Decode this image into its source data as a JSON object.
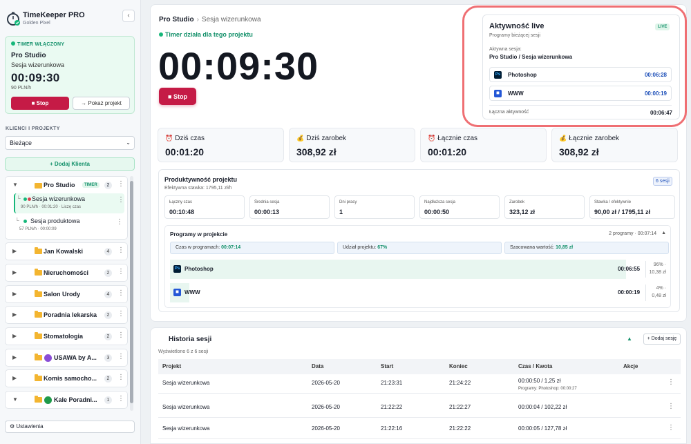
{
  "app": {
    "name": "TimeKeeper PRO",
    "subtitle": "Golden Pixel",
    "collapse_icon": "chevron-left-icon"
  },
  "sidebar": {
    "timer_card": {
      "label": "TIMER WŁĄCZONY",
      "project": "Pro Studio",
      "session": "Sesja wizerunkowa",
      "time": "00:09:30",
      "rate": "90 PLN/h",
      "stop_label": "■ Stop",
      "show_label": "→ Pokaż projekt"
    },
    "section_label": "KLIENCI I PROJEKTY",
    "filter_value": "Bieżące",
    "add_client_label": "+ Dodaj Klienta",
    "open_client": {
      "name": "Pro Studio",
      "tag": "TIMER",
      "count": "2",
      "sessions": [
        {
          "name": "Sesja wizerunkowa",
          "meta": "90 PLN/h · 00:01:20 · Liczę czas"
        },
        {
          "name": "Sesja produktowa",
          "meta": "57 PLN/h · 00:00:09"
        }
      ]
    },
    "clients": [
      {
        "name": "Jan Kowalski",
        "count": "4",
        "expanded": false
      },
      {
        "name": "Nieruchomości",
        "count": "2",
        "expanded": false
      },
      {
        "name": "Salon Urody",
        "count": "4",
        "expanded": false
      },
      {
        "name": "Poradnia lekarska",
        "count": "2",
        "expanded": false
      },
      {
        "name": "Stomatologia",
        "count": "2",
        "expanded": false
      },
      {
        "name": "USAWA by A...",
        "count": "3",
        "expanded": false,
        "icon_color": "#8a4dd6"
      },
      {
        "name": "Komis samocho...",
        "count": "2",
        "expanded": false
      },
      {
        "name": "Kale Poradni...",
        "count": "1",
        "expanded": true,
        "icon_color": "#1f9a4a"
      }
    ],
    "settings_label": "⚙ Ustawienia"
  },
  "main": {
    "breadcrumb": {
      "project": "Pro Studio",
      "separator": "›",
      "session": "Sesja wizerunkowa"
    },
    "status": "Timer działa dla tego projektu",
    "time": "00:09:30",
    "stop_label": "■ Stop",
    "live": {
      "title": "Aktywność live",
      "subtitle": "Programy bieżącej sesji",
      "badge": "LIVE",
      "active_label": "Aktywna sesja:",
      "active_value": "Pro Studio / Sesja wizerunkowa",
      "programs": [
        {
          "icon": "Ps",
          "name": "Photoshop",
          "time": "00:06:28"
        },
        {
          "icon": "◼",
          "name": "WWW",
          "time": "00:00:19"
        }
      ],
      "total_label": "Łączna aktywność",
      "total_value": "00:06:47"
    },
    "stats": [
      {
        "icon": "⏰",
        "label": "Dziś czas",
        "value": "00:01:20"
      },
      {
        "icon": "💰",
        "label": "Dziś zarobek",
        "value": "308,92 zł"
      },
      {
        "icon": "⏰",
        "label": "Łącznie czas",
        "value": "00:01:20"
      },
      {
        "icon": "💰",
        "label": "Łącznie zarobek",
        "value": "308,92 zł"
      }
    ],
    "productivity": {
      "title": "Produktywność projektu",
      "subtitle": "Efektywna stawka: 1795,11 zł/h",
      "badge": "6 sesji",
      "metrics": [
        {
          "label": "Łączny czas",
          "value": "00:10:48"
        },
        {
          "label": "Średnia sesja",
          "value": "00:00:13"
        },
        {
          "label": "Dni pracy",
          "value": "1"
        },
        {
          "label": "Najdłuższa sesja",
          "value": "00:00:50"
        },
        {
          "label": "Zarobek",
          "value": "323,12 zł"
        },
        {
          "label": "Stawka / efektywnie",
          "value": "90,00 zł / 1795,11 zł"
        }
      ],
      "programs_box": {
        "title": "Programy w projekcie",
        "summary": "2 programy · 00:07:14",
        "caret": "▲",
        "chips": [
          {
            "label": "Czas w programach: ",
            "value": "00:07:14"
          },
          {
            "label": "Udział projektu: ",
            "value": "67%"
          },
          {
            "label": "Szacowana wartość: ",
            "value": "10,85 zł"
          }
        ],
        "rows": [
          {
            "icon": "Ps",
            "name": "Photoshop",
            "time": "00:06:55",
            "share_pct": "96% ·",
            "share_val": "10,38 zł",
            "fill_fraction": 0.96
          },
          {
            "icon": "◼",
            "name": "WWW",
            "time": "00:00:19",
            "share_pct": "4% ·",
            "share_val": "0,48 zł",
            "fill_fraction": 0.04
          }
        ]
      }
    }
  },
  "history": {
    "title": "Historia sesji",
    "subtitle": "Wyświetlono 6 z 6 sesji",
    "caret": "▲",
    "add_label": "+ Dodaj sesję",
    "columns": [
      "Projekt",
      "Data",
      "Start",
      "Koniec",
      "Czas / Kwota",
      "Akcje"
    ],
    "rows": [
      {
        "project": "Sesja wizerunkowa",
        "date": "2026-05-20",
        "start": "21:23:31",
        "end": "21:24:22",
        "amount": "00:00:50 / 1,25 zł",
        "note": "Programy: Photoshop: 00:00:27"
      },
      {
        "project": "Sesja wizerunkowa",
        "date": "2026-05-20",
        "start": "21:22:22",
        "end": "21:22:27",
        "amount": "00:00:04 / 102,22 zł",
        "note": ""
      },
      {
        "project": "Sesja wizerunkowa",
        "date": "2026-05-20",
        "start": "21:22:16",
        "end": "21:22:22",
        "amount": "00:00:05 / 127,78 zł",
        "note": ""
      }
    ]
  }
}
